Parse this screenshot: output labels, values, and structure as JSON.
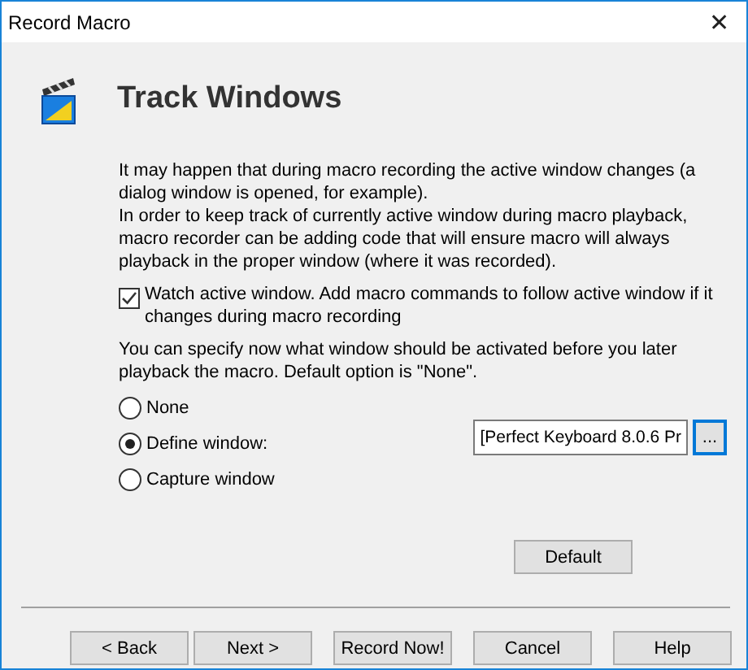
{
  "window": {
    "title": "Record Macro",
    "close": "✕"
  },
  "header": {
    "title": "Track Windows"
  },
  "description": "It may happen that during macro recording the active window changes (a dialog window is opened, for example).\nIn order to keep track of currently active window during macro playback, macro recorder can be adding code that will ensure macro will always playback in the proper window (where it was recorded).",
  "watch": {
    "label": "Watch active window. Add macro commands to follow active window if it changes during macro recording",
    "checked": true
  },
  "hint": "You can specify now what window should be activated before you later playback the macro.  Default option is \"None\".",
  "options": [
    {
      "label": "None",
      "selected": false
    },
    {
      "label": "Define window:",
      "selected": true
    },
    {
      "label": "Capture window",
      "selected": false
    }
  ],
  "window_field": {
    "value": "[Perfect Keyboard 8.0.6 Pr",
    "browse": "..."
  },
  "default_button": "Default",
  "buttons": [
    "< Back",
    "Next >",
    "Record Now!",
    "Cancel",
    "Help"
  ]
}
